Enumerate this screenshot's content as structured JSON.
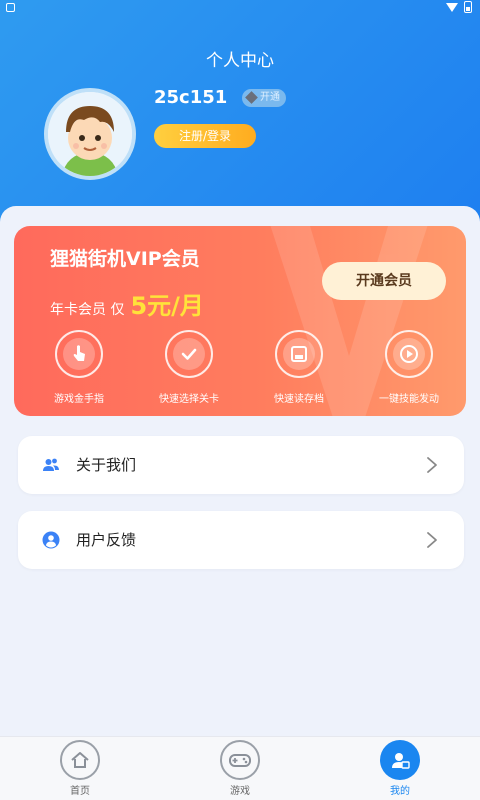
{
  "header": {
    "title": "个人中心",
    "username": "25c151",
    "vip_tag": "开通",
    "login_button": "注册/登录"
  },
  "vip_card": {
    "title": "狸猫街机VIP会员",
    "price_prefix": "年卡会员 仅",
    "price": "5元/月",
    "open_button": "开通会员",
    "perks": [
      {
        "icon": "hand-pointer-icon",
        "label": "游戏金手指"
      },
      {
        "icon": "check-circle-icon",
        "label": "快速选择关卡"
      },
      {
        "icon": "save-icon",
        "label": "快速读存档"
      },
      {
        "icon": "play-icon",
        "label": "一键技能发动"
      }
    ]
  },
  "menu": [
    {
      "icon": "users-icon",
      "label": "关于我们"
    },
    {
      "icon": "user-circle-icon",
      "label": "用户反馈"
    }
  ],
  "tabbar": [
    {
      "icon": "home-icon",
      "label": "首页",
      "active": false
    },
    {
      "icon": "gamepad-icon",
      "label": "游戏",
      "active": false
    },
    {
      "icon": "profile-icon",
      "label": "我的",
      "active": true
    }
  ],
  "colors": {
    "header_blue": "#1e7ff0",
    "vip_orange": "#ff6a5c",
    "accent_yellow": "#ffe23a",
    "active_tab": "#1a86f0"
  }
}
